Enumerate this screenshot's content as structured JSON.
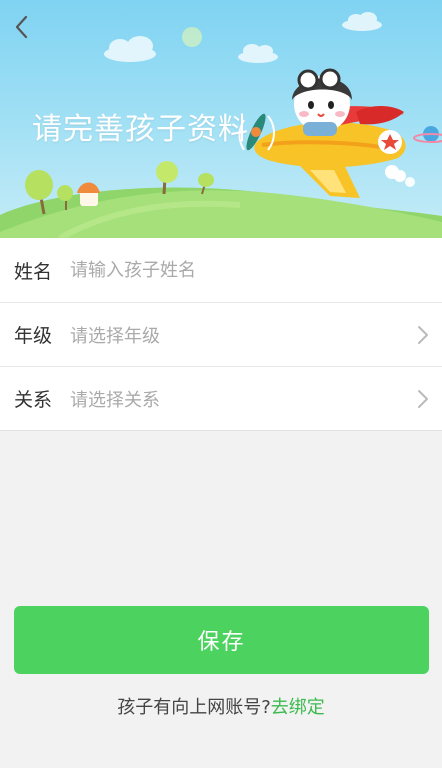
{
  "header": {
    "back_icon": "chevron-left-icon",
    "banner_title": "请完善孩子资料"
  },
  "form": {
    "name": {
      "label": "姓名",
      "placeholder": "请输入孩子姓名",
      "value": ""
    },
    "grade": {
      "label": "年级",
      "placeholder": "请选择年级",
      "icon": "chevron-right-icon"
    },
    "relation": {
      "label": "关系",
      "placeholder": "请选择关系",
      "icon": "chevron-right-icon"
    }
  },
  "actions": {
    "save_label": "保存",
    "bind_prompt": "孩子有向上网账号?",
    "bind_link": "去绑定"
  },
  "colors": {
    "accent_green": "#4cd35f",
    "link_green": "#3cba4f",
    "sky_blue": "#7fd3f2",
    "background": "#f2f2f2"
  }
}
